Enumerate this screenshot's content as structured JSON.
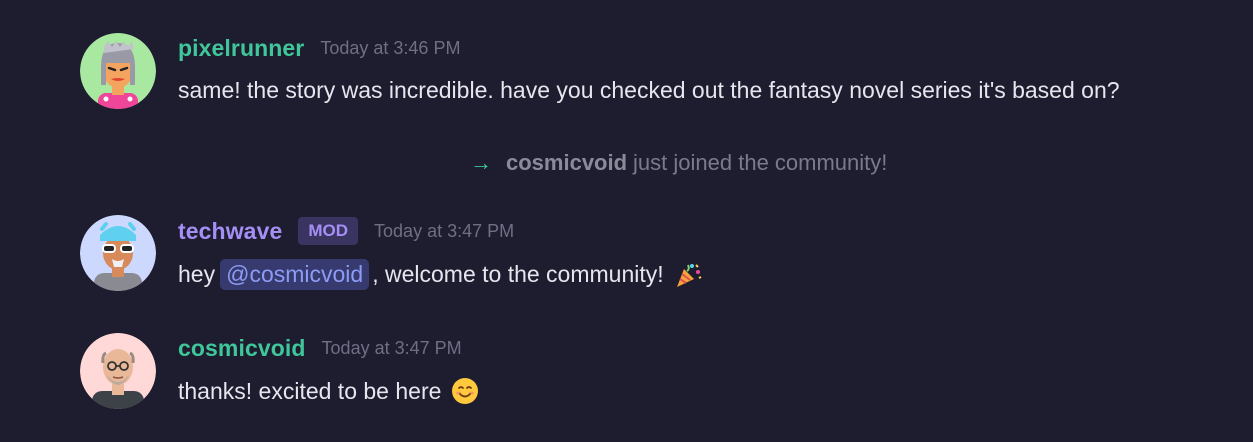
{
  "colors": {
    "background": "#1e1d30",
    "username_green": "#3fc79a",
    "username_purple": "#a58ff5",
    "mention_bg": "#363a6e",
    "mention_text": "#8e9bf5"
  },
  "messages": [
    {
      "username": "pixelrunner",
      "timestamp": "Today at 3:46 PM",
      "text": "same! the story was incredible. have you checked out the fantasy novel series it's based on?",
      "avatar_icon": "avatar-pixelrunner-icon"
    },
    {
      "username": "techwave",
      "badge": "MOD",
      "timestamp": "Today at 3:47 PM",
      "text_before": "hey",
      "mention": "@cosmicvoid",
      "text_after": ", welcome to the community!",
      "emoji": "party-popper-icon",
      "avatar_icon": "avatar-techwave-icon"
    },
    {
      "username": "cosmicvoid",
      "timestamp": "Today at 3:47 PM",
      "text": "thanks! excited to be here",
      "emoji": "smiling-face-icon",
      "avatar_icon": "avatar-cosmicvoid-icon"
    }
  ],
  "system_message": {
    "icon": "arrow-right-icon",
    "username": "cosmicvoid",
    "text": "just joined the community!"
  }
}
